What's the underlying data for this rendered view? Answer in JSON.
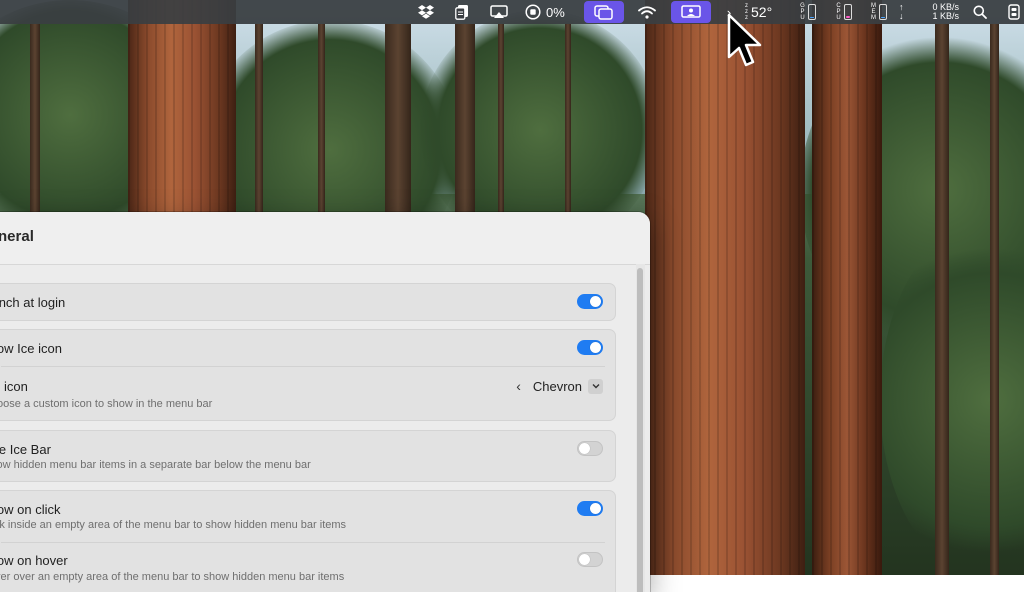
{
  "menubar": {
    "battery_percent": "0%",
    "temperature": "52°",
    "gpu_label": [
      "G",
      "P",
      "U"
    ],
    "cpu_label": [
      "C",
      "P",
      "U"
    ],
    "mem_label": [
      "M",
      "E",
      "M"
    ],
    "net_up": "0 KB/s",
    "net_down": "1 KB/s",
    "zzz_label": [
      "z",
      "z",
      "z"
    ]
  },
  "window": {
    "title": "General",
    "launch_at_login": {
      "label": "Launch at login",
      "enabled": true
    },
    "show_ice_icon": {
      "label": "Show Ice icon",
      "enabled": true
    },
    "ice_icon": {
      "label": "Ice icon",
      "description": "Choose a custom icon to show in the menu bar",
      "value": "Chevron"
    },
    "use_ice_bar": {
      "label": "Use Ice Bar",
      "description": "Show hidden menu bar items in a separate bar below the menu bar",
      "enabled": false
    },
    "show_on_click": {
      "label": "Show on click",
      "description": "Click inside an empty area of the menu bar to show hidden menu bar items",
      "enabled": true
    },
    "show_on_hover": {
      "label": "Show on hover",
      "description": "Hover over an empty area of the menu bar to show hidden menu bar items",
      "enabled": false
    }
  },
  "colors": {
    "accent": "#1f7cf2",
    "highlight": "#6a55e8"
  }
}
